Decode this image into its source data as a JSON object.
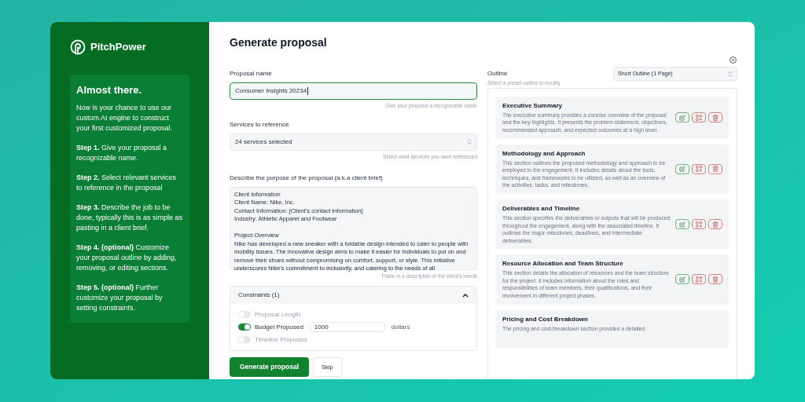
{
  "brand": {
    "name": "PitchPower"
  },
  "intro": {
    "title": "Almost there.",
    "text": "Now is your chance to use our custom AI engine to construct your first customized proposal.",
    "steps": [
      {
        "text": "**Step 1.** Give your proposal a recognizable name."
      },
      {
        "text": "**Step 2.** Select relevant services to reference in the proposal"
      },
      {
        "text": "**Step 3.** Describe the job to be done, typically this is as simple as pasting in a client brief."
      },
      {
        "text": "**Step 4. (optional)** Customize your proposal outline by adding, removing, or editing sections."
      },
      {
        "text": "**Step 5. (optional)** Further customize your proposal by setting constraints."
      }
    ]
  },
  "page_title": "Generate proposal",
  "form": {
    "name_field": {
      "label": "Proposal name",
      "value": "Consumer Insights 20234",
      "hint": "Give your proposal a recognizable name"
    },
    "services": {
      "label": "Services to reference",
      "value": "24 services selected",
      "hint": "Select what services you want referenced"
    },
    "brief": {
      "label": "Describe the purpose of the proposal (a.k.a client brief)",
      "text": "Client Information\nClient Name: Nike, Inc.\nContact Information: [Client's contact information]\nIndustry: Athletic Apparel and Footwear\n\nProject Overview\nNike has developed a new sneaker with a foldable design intended to cater to people with mobility issues. The innovative design aims to make it easier for individuals to put on and remove their shoes without compromising on comfort, support, or style. This initiative underscores Nike's commitment to inclusivity, and catering to the needs of all",
      "hint": "Paste in a description of the client's needs"
    },
    "constraints": {
      "title": "Constraints (1)",
      "expanded": true,
      "items": [
        {
          "label": "Proposal Length",
          "on": false
        },
        {
          "label": "Budget Proposed",
          "on": true,
          "value": "1000",
          "unit": "dollars"
        },
        {
          "label": "Timeline Proposed",
          "on": false
        }
      ]
    },
    "buttons": [
      {
        "label": "Generate proposal",
        "kind": "primary"
      },
      {
        "label": "Skip",
        "kind": "secondary"
      }
    ]
  },
  "outline": {
    "label": "Outline",
    "hint": "Select a preset outline to modify",
    "preset": "Short Outline (1 Page)",
    "sections": [
      {
        "title": "Executive Summary",
        "description": "The executive summary provides a concise overview of the proposal and the key highlights. It presents the problem statement, objectives, recommended approach, and expected outcomes at a high level.",
        "actions": true
      },
      {
        "title": "Methodology and Approach",
        "description": "This section outlines the proposed methodology and approach to be employed in the engagement. It includes details about the tools, techniques, and frameworks to be utilized, as well as an overview of the activities, tasks, and milestones.",
        "actions": true
      },
      {
        "title": "Deliverables and Timeline",
        "description": "This section specifies the deliverables or outputs that will be produced throughout the engagement, along with the associated timeline. It outlines the major milestones, deadlines, and intermediate deliverables.",
        "actions": true
      },
      {
        "title": "Resource Allocation and Team Structure",
        "description": "This section details the allocation of resources and the team structure for the project. It includes information about the roles and responsibilities of team members, their qualifications, and their involvement in different project phases.",
        "actions": true
      },
      {
        "title": "Pricing and Cost Breakdown",
        "description": "The pricing and cost breakdown section provides a detailed",
        "actions": false
      }
    ]
  }
}
